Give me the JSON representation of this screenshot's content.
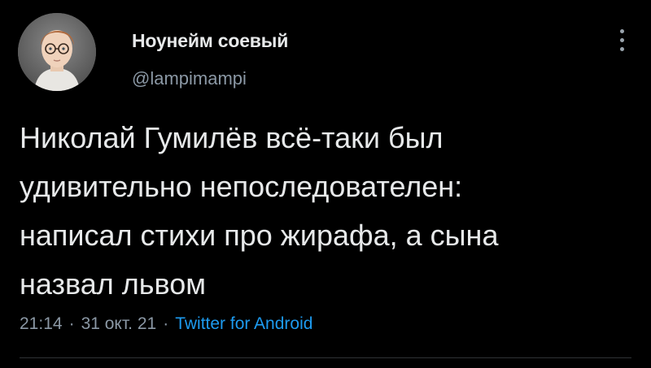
{
  "author": {
    "display_name": "Ноунейм соевый",
    "handle": "@lampimampi"
  },
  "tweet": {
    "lines": [
      "Николай Гумилёв всё-таки был",
      "удивительно непоследователен:",
      "написал стихи про жирафа, а сына",
      "назвал львом"
    ],
    "time": "21:14",
    "date": "31 окт. 21",
    "separator": "·",
    "source": "Twitter for Android"
  },
  "colors": {
    "background": "#000000",
    "text": "#e7e9ea",
    "secondary": "#8b98a5",
    "link": "#1d9bf0"
  },
  "icons": {
    "more": "more-vertical-icon"
  }
}
